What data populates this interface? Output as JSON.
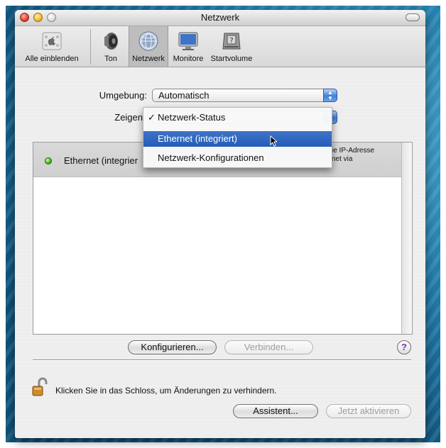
{
  "window": {
    "title": "Netzwerk"
  },
  "toolbar": {
    "items": [
      {
        "label": "Alle einblenden",
        "icon": "apple-logo-icon"
      },
      {
        "label": "Ton",
        "icon": "speaker-icon"
      },
      {
        "label": "Netzwerk",
        "icon": "network-globe-icon",
        "selected": true
      },
      {
        "label": "Monitore",
        "icon": "monitor-icon"
      },
      {
        "label": "Startvolume",
        "icon": "startup-disk-icon"
      }
    ]
  },
  "location": {
    "label": "Umgebung:",
    "value": "Automatisch"
  },
  "show": {
    "label": "Zeigen"
  },
  "show_menu": {
    "items": [
      {
        "label": "Netzwerk-Status",
        "checked": true
      },
      {
        "label": "Ethernet (integriert)",
        "highlighted": true
      },
      {
        "label": "Netzwerk-Konfigurationen"
      }
    ]
  },
  "status_list": {
    "row": {
      "name": "Ethernet (integrier",
      "desc_line1": "ie IP-Adresse",
      "desc_line2": "net via",
      "status_color": "#3fb21d"
    }
  },
  "buttons": {
    "configure": "Konfigurieren...",
    "connect": "Verbinden...",
    "help": "?",
    "assistant": "Assistent...",
    "activate_now": "Jetzt aktivieren"
  },
  "lock": {
    "text": "Klicken Sie in das Schloss, um Änderungen zu verhindern."
  },
  "colors": {
    "selection": "#245cb8",
    "accent": "#3f7fd6"
  }
}
